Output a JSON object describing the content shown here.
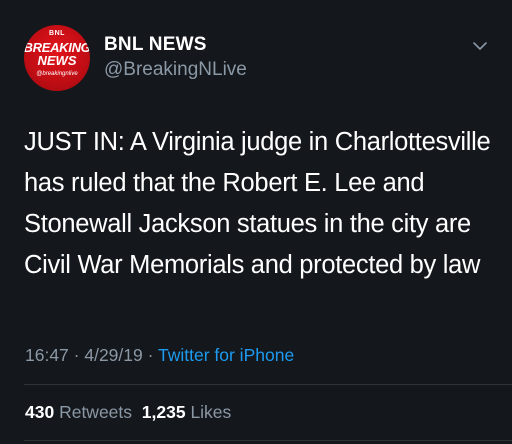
{
  "author": {
    "name": "BNL NEWS",
    "handle": "@BreakingNLive",
    "avatar": {
      "line_small": "BNL",
      "line_big1": "BREAKING",
      "line_big2": "NEWS",
      "line_handle": "@breakingnlive"
    }
  },
  "tweet": {
    "text": "JUST IN: A Virginia judge in Charlottesville has ruled that the Robert E. Lee and Stonewall Jackson statues in the city are Civil War Memorials and protected by law",
    "time": "16:47",
    "separator1": " · ",
    "date": "4/29/19",
    "separator2": " · ",
    "source": "Twitter for iPhone"
  },
  "stats": {
    "retweets_count": "430",
    "retweets_label": "Retweets",
    "likes_count": "1,235",
    "likes_label": "Likes"
  },
  "colors": {
    "background": "#14171c",
    "text_primary": "#ffffff",
    "text_secondary": "#8b98a5",
    "link": "#1d9bf0",
    "avatar_red": "#d0121a"
  },
  "icons": {
    "menu": "chevron-down-icon"
  }
}
